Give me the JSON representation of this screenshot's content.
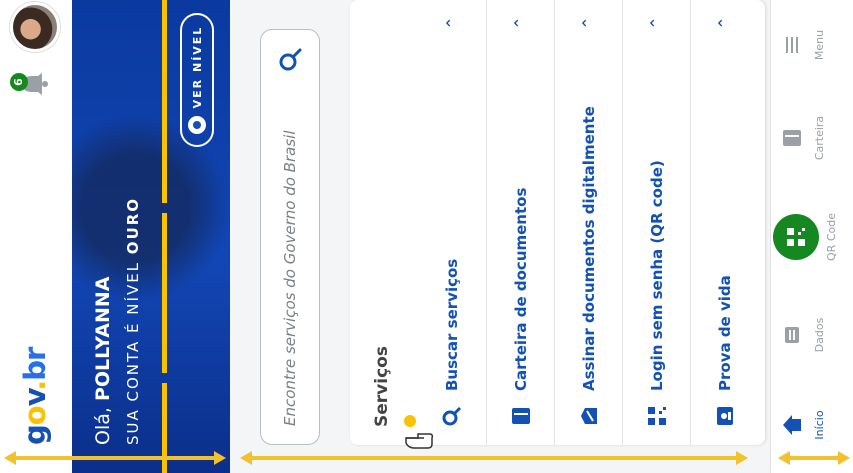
{
  "app": {
    "logo": {
      "g": "g",
      "o": "o",
      "v": "v",
      "dot": ".",
      "br": "br"
    },
    "notifications_count": "6"
  },
  "hero": {
    "greeting_prefix": "Olá, ",
    "user_name": "POLLYANNA",
    "level_prefix": "SUA CONTA É NÍVEL ",
    "level": "OURO",
    "view_level_label": "VER NÍVEL"
  },
  "search": {
    "placeholder": "Encontre serviços do Governo do Brasil",
    "icon": "search-icon"
  },
  "services": {
    "title": "Serviços",
    "items": [
      {
        "label": "Buscar serviços",
        "icon": "search-icon"
      },
      {
        "label": "Carteira de documentos",
        "icon": "wallet-icon"
      },
      {
        "label": "Assinar documentos digitalmente",
        "icon": "signature-icon"
      },
      {
        "label": "Login sem senha (QR code)",
        "icon": "qr-code-icon"
      },
      {
        "label": "Prova de vida",
        "icon": "id-card-icon"
      }
    ]
  },
  "nav": {
    "items": [
      {
        "label": "Início",
        "icon": "home-icon"
      },
      {
        "label": "Dados",
        "icon": "data-icon"
      },
      {
        "label": "QR Code",
        "icon": "qr-code-icon"
      },
      {
        "label": "Carteira",
        "icon": "wallet-icon"
      },
      {
        "label": "Menu",
        "icon": "menu-icon"
      }
    ]
  },
  "colors": {
    "brand_blue": "#1351b4",
    "brand_yellow": "#f8c300",
    "brand_green": "#168821"
  }
}
